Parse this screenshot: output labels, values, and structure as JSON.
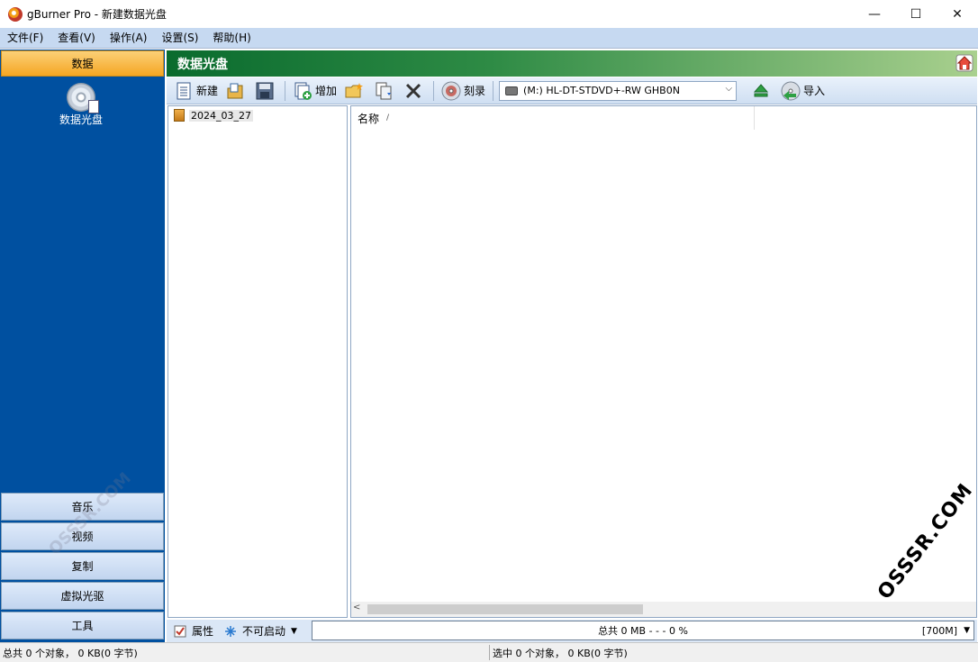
{
  "window": {
    "title": "gBurner Pro - 新建数据光盘",
    "minimize": "—",
    "maximize": "☐",
    "close": "✕"
  },
  "menu": [
    "文件(F)",
    "查看(V)",
    "操作(A)",
    "设置(S)",
    "帮助(H)"
  ],
  "sidebar": {
    "active": "数据",
    "active_item_label": "数据光盘",
    "buttons": [
      "音乐",
      "视频",
      "复制",
      "虚拟光驱",
      "工具"
    ]
  },
  "header": {
    "title": "数据光盘"
  },
  "toolbar": {
    "new_label": "新建",
    "add_label": "增加",
    "burn_label": "刻录",
    "drive": "(M:) HL-DT-STDVD+-RW GHB0N",
    "import_label": "导入"
  },
  "tree": {
    "root": "2024_03_27"
  },
  "list": {
    "column_name": "名称",
    "sort_marker": "/"
  },
  "bottom": {
    "properties_label": "属性",
    "boot_label": "不可启动",
    "capacity_text": "总共 0 MB   - - - 0 %",
    "capacity_size": "[700M]"
  },
  "status": {
    "left": "总共 0 个对象， 0 KB(0 字节)",
    "right": "选中 0 个对象， 0 KB(0 字节)"
  },
  "watermark": {
    "text": "OSSSR.COM"
  }
}
